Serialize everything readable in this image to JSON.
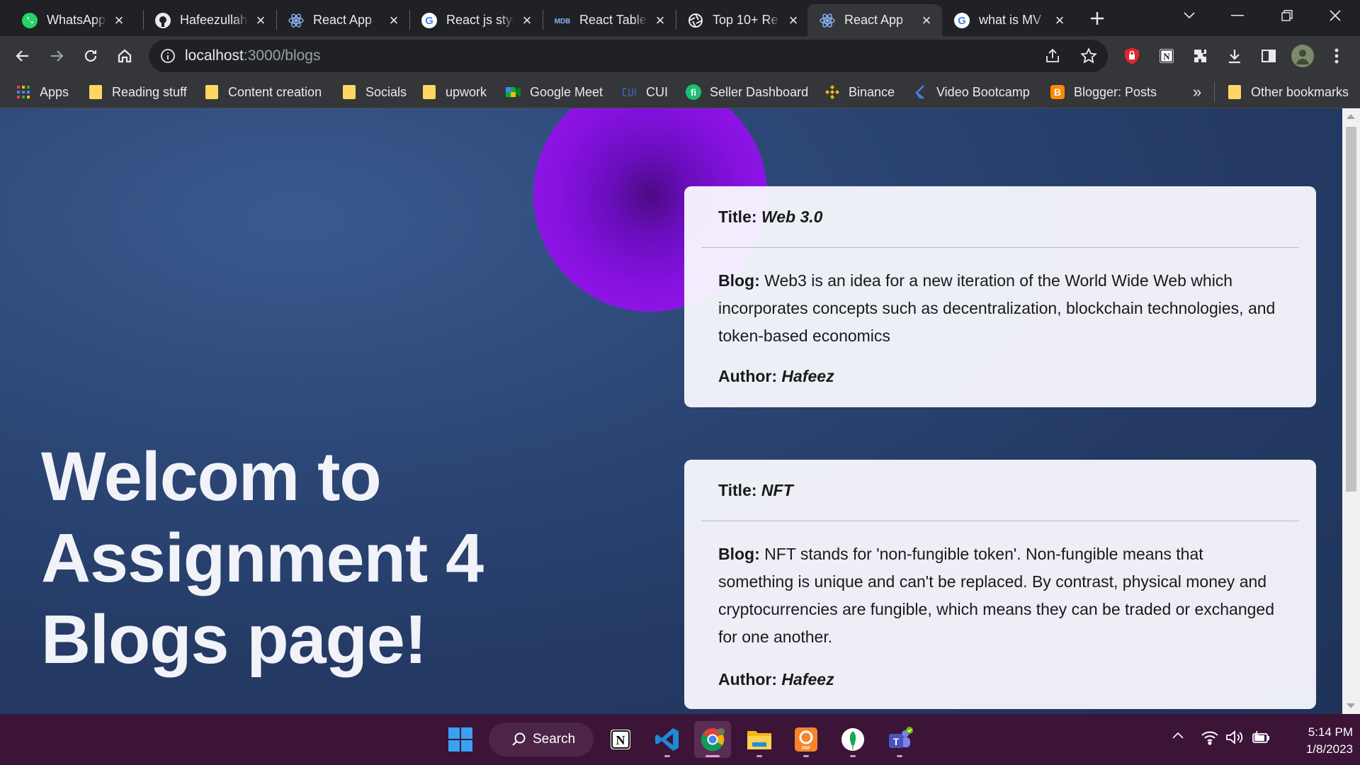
{
  "tabs": [
    {
      "title": "WhatsApp",
      "icon": "whatsapp-icon",
      "active": false
    },
    {
      "title": "Hafeezullah",
      "icon": "github-icon",
      "active": false
    },
    {
      "title": "React App",
      "icon": "react-icon",
      "active": false
    },
    {
      "title": "React js styl",
      "icon": "google-icon",
      "active": false
    },
    {
      "title": "React Table",
      "icon": "mdb-icon",
      "active": false
    },
    {
      "title": "Top 10+ Re",
      "icon": "aperture-icon",
      "active": false
    },
    {
      "title": "React App",
      "icon": "react-icon",
      "active": true
    },
    {
      "title": "what is MV",
      "icon": "google-icon",
      "active": false
    }
  ],
  "mdb_label": "MDB",
  "toolbar": {
    "url_host": "localhost",
    "url_path": ":3000/blogs"
  },
  "bookmarks": [
    {
      "label": "Apps",
      "icon": "apps-grid-icon"
    },
    {
      "label": "Reading stuff",
      "icon": "folder-icon"
    },
    {
      "label": "Content creation",
      "icon": "folder-icon"
    },
    {
      "label": "Socials",
      "icon": "folder-icon"
    },
    {
      "label": "upwork",
      "icon": "folder-icon"
    },
    {
      "label": "Google Meet",
      "icon": "google-meet-icon"
    },
    {
      "label": "CUI",
      "icon": "cui-icon"
    },
    {
      "label": "Seller Dashboard",
      "icon": "fiverr-icon"
    },
    {
      "label": "Binance",
      "icon": "binance-icon"
    },
    {
      "label": "Video Bootcamp",
      "icon": "bootcamp-icon"
    },
    {
      "label": "Blogger: Posts",
      "icon": "blogger-icon"
    }
  ],
  "bookmarks_overflow": "»",
  "other_bookmarks": "Other bookmarks",
  "page": {
    "heading_lines": [
      "Welcom to",
      "Assignment 4",
      "Blogs page!"
    ],
    "posts": [
      {
        "title_label": "Title:",
        "title": "Web 3.0",
        "blog_label": "Blog:",
        "blog": "Web3 is an idea for a new iteration of the World Wide Web which incorporates concepts such as decentralization, blockchain technologies, and token-based economics",
        "author_label": "Author:",
        "author": "Hafeez"
      },
      {
        "title_label": "Title:",
        "title": "NFT",
        "blog_label": "Blog:",
        "blog": "NFT stands for 'non-fungible token'. Non-fungible means that something is unique and can't be replaced. By contrast, physical money and cryptocurrencies are fungible, which means they can be traded or exchanged for one another.",
        "author_label": "Author:",
        "author": "Hafeez"
      }
    ]
  },
  "taskbar": {
    "search_label": "Search",
    "time": "5:14 PM",
    "date": "1/8/2023"
  },
  "colors": {
    "accent_orb": "#8611e0",
    "page_bg": "#2c4676",
    "taskbar_bg": "#3b1438"
  }
}
